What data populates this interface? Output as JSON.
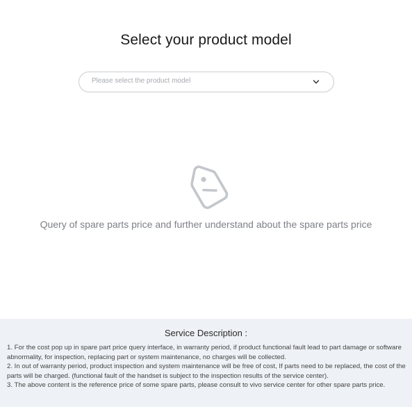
{
  "page": {
    "title": "Select your product model"
  },
  "model_select": {
    "placeholder": "Please select the product model",
    "icon": "chevron-down-icon"
  },
  "empty_state": {
    "icon": "price-tag-icon",
    "text": "Query of spare parts price and further understand about the spare parts price"
  },
  "service_description": {
    "title": "Service Description :",
    "items": [
      "1. For the cost pop up in spare part price query interface, in warranty period, if product functional fault lead to part damage or software abnormality, for inspection, replacing part or system maintenance, no charges will be collected.",
      "2. In out of warranty period, product inspection and system maintenance will be free of cost, If parts need to be replaced, the cost of the parts will be charged. (functional fault of the handset is subject to the inspection results of the service center).",
      "3. The above content is the reference price of some spare parts, please consult to vivo service center for other spare parts price."
    ]
  },
  "colors": {
    "background": "#ffffff",
    "panel": "#eef1f5",
    "border": "#c9ccd1",
    "icon": "#c3c6cb"
  }
}
